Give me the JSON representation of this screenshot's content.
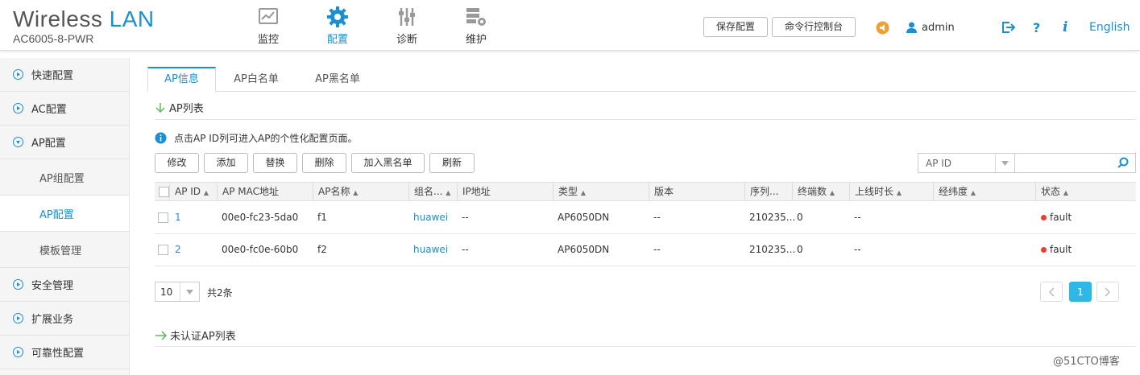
{
  "brand": {
    "title_a": "Wireless",
    "title_b": "LAN",
    "model": "AC6005-8-PWR"
  },
  "nav": [
    {
      "label": "监控",
      "icon": "monitor-icon"
    },
    {
      "label": "配置",
      "icon": "gear-icon"
    },
    {
      "label": "诊断",
      "icon": "sliders-icon"
    },
    {
      "label": "维护",
      "icon": "server-gear-icon"
    }
  ],
  "nav_active": "配置",
  "header": {
    "save_label": "保存配置",
    "cli_label": "命令行控制台",
    "user": "admin",
    "language": "English",
    "help": "?",
    "info": "i"
  },
  "sidebar": {
    "items": [
      {
        "label": "快速配置"
      },
      {
        "label": "AC配置"
      },
      {
        "label": "AP配置"
      },
      {
        "label": "安全管理"
      },
      {
        "label": "扩展业务"
      },
      {
        "label": "可靠性配置"
      }
    ],
    "sub_items": [
      {
        "label": "AP组配置"
      },
      {
        "label": "AP配置"
      },
      {
        "label": "模板管理"
      }
    ]
  },
  "tabs": [
    {
      "label": "AP信息"
    },
    {
      "label": "AP白名单"
    },
    {
      "label": "AP黑名单"
    }
  ],
  "section_ap_list": "AP列表",
  "info_text": "点击AP ID列可进入AP的个性化配置页面。",
  "buttons": {
    "modify": "修改",
    "add": "添加",
    "replace": "替换",
    "delete": "删除",
    "blacklist": "加入黑名单",
    "refresh": "刷新"
  },
  "search": {
    "field_selected": "AP ID",
    "value": ""
  },
  "table": {
    "columns": [
      "AP ID",
      "AP MAC地址",
      "AP名称",
      "组名...",
      "IP地址",
      "类型",
      "版本",
      "序列...",
      "终端数",
      "上线时长",
      "经纬度",
      "状态"
    ],
    "rows": [
      {
        "id": "1",
        "mac": "00e0-fc23-5da0",
        "name": "f1",
        "group": "huawei",
        "ip": "--",
        "type": "AP6050DN",
        "version": "--",
        "serial": "210235...",
        "clients": "0",
        "uptime": "--",
        "geo": "",
        "status": "fault"
      },
      {
        "id": "2",
        "mac": "00e0-fc0e-60b0",
        "name": "f2",
        "group": "huawei",
        "ip": "--",
        "type": "AP6050DN",
        "version": "--",
        "serial": "210235...",
        "clients": "0",
        "uptime": "--",
        "geo": "",
        "status": "fault"
      }
    ]
  },
  "pagination": {
    "page_size": "10",
    "total": "共2条",
    "current_page": "1"
  },
  "section_unauth": "未认证AP列表",
  "watermark": "@51CTO博客",
  "colors": {
    "accent": "#1a8fd1",
    "fault": "#e8412e",
    "warning": "#f0a030"
  }
}
